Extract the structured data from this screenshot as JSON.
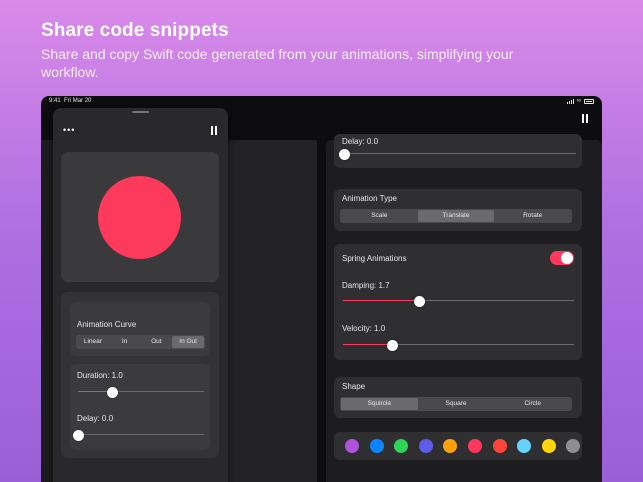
{
  "header": {
    "title": "Share code snippets",
    "subtitle": "Share and copy Swift code generated from your animations, simplifying your workflow."
  },
  "statusbar": {
    "time": "9:41",
    "date": "Fri Mar 20"
  },
  "left_panel": {
    "curve": {
      "label": "Animation Curve",
      "options": [
        "Linear",
        "In",
        "Out",
        "In Out"
      ],
      "selected": "In Out"
    },
    "duration": {
      "label": "Duration: 1.0",
      "value": 1.0,
      "fraction": 0.27
    },
    "delay": {
      "label": "Delay: 0.0",
      "value": 0.0,
      "fraction": 0.0
    },
    "ball_color": "#fd3a5c"
  },
  "right_panel": {
    "delay": {
      "label": "Delay: 0.0",
      "value": 0.0,
      "fraction": 0.0
    },
    "animation_type": {
      "label": "Animation Type",
      "options": [
        "Scale",
        "Translate",
        "Rotate"
      ],
      "selected": "Translate"
    },
    "spring": {
      "label": "Spring Animations",
      "enabled": true,
      "damping": {
        "label": "Damping: 1.7",
        "value": 1.7,
        "fraction": 0.33
      },
      "velocity": {
        "label": "Velocity: 1.0",
        "value": 1.0,
        "fraction": 0.21
      }
    },
    "shape": {
      "label": "Shape",
      "options": [
        "Squircle",
        "Square",
        "Circle"
      ],
      "selected": "Squircle"
    },
    "palette": [
      "#af52de",
      "#0a84ff",
      "#30d158",
      "#5e5ce6",
      "#ff9f0a",
      "#ff375f",
      "#ff453a",
      "#64d2ff",
      "#ffd60a",
      "#8e8e93"
    ]
  },
  "accent": "#fd3a5c"
}
